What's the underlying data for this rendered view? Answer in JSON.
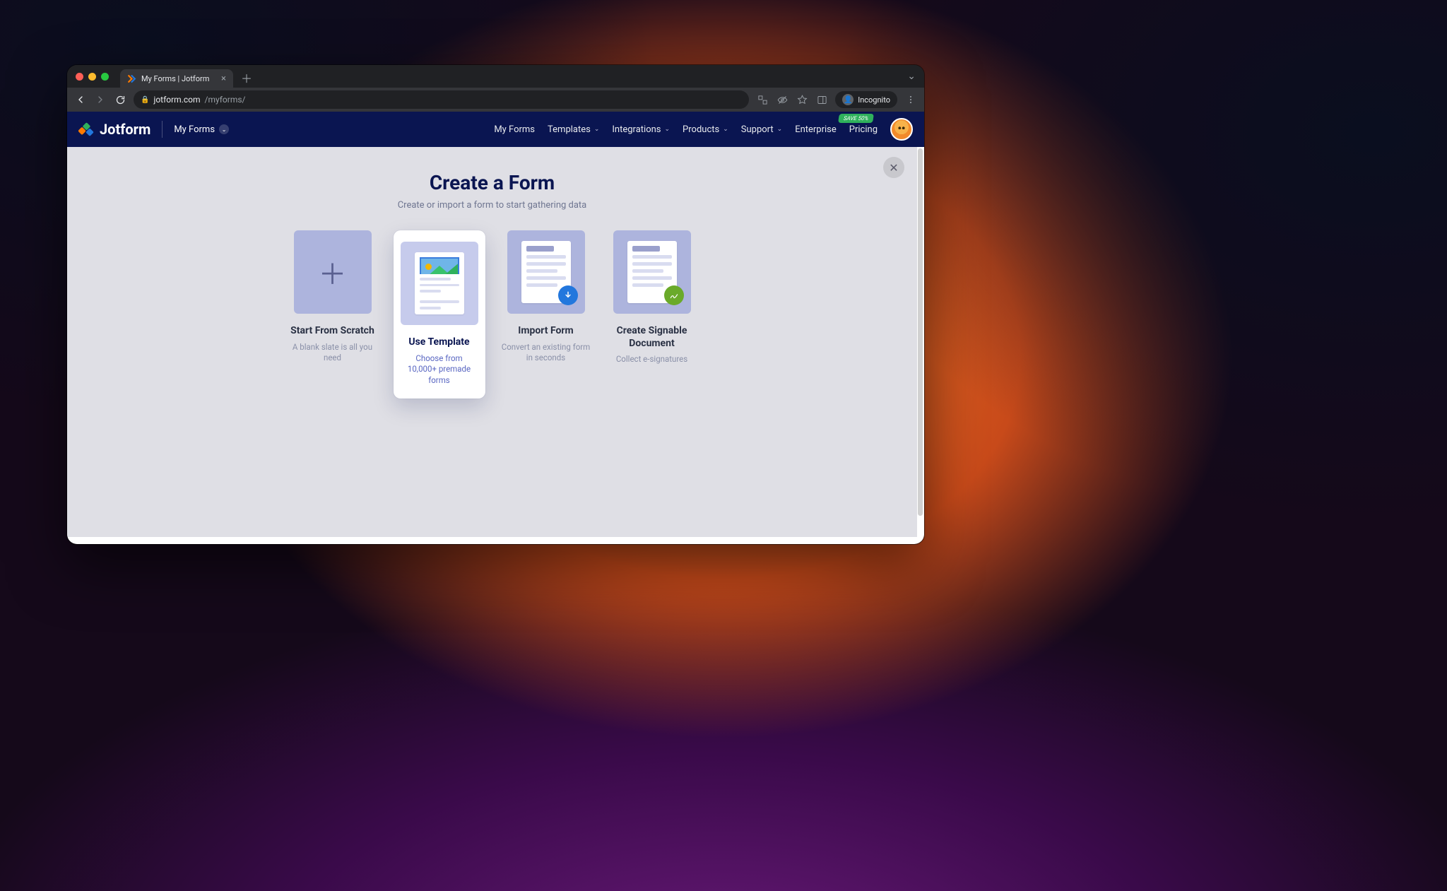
{
  "browser": {
    "tab_title": "My Forms | Jotform",
    "url_domain": "jotform.com",
    "url_path": "/myforms/",
    "incognito_label": "Incognito"
  },
  "header": {
    "brand": "Jotform",
    "breadcrumb": "My Forms",
    "nav": {
      "my_forms": "My Forms",
      "templates": "Templates",
      "integrations": "Integrations",
      "products": "Products",
      "support": "Support",
      "enterprise": "Enterprise",
      "pricing": "Pricing"
    },
    "save_badge": "SAVE 50%"
  },
  "modal": {
    "title": "Create a Form",
    "subtitle": "Create or import a form to start gathering data",
    "cards": {
      "scratch": {
        "title": "Start From Scratch",
        "desc": "A blank slate is all you need"
      },
      "template": {
        "title": "Use Template",
        "desc": "Choose from 10,000+ premade forms"
      },
      "import": {
        "title": "Import Form",
        "desc": "Convert an existing form in seconds"
      },
      "signable": {
        "title": "Create Signable Document",
        "desc": "Collect e-signatures"
      }
    }
  }
}
